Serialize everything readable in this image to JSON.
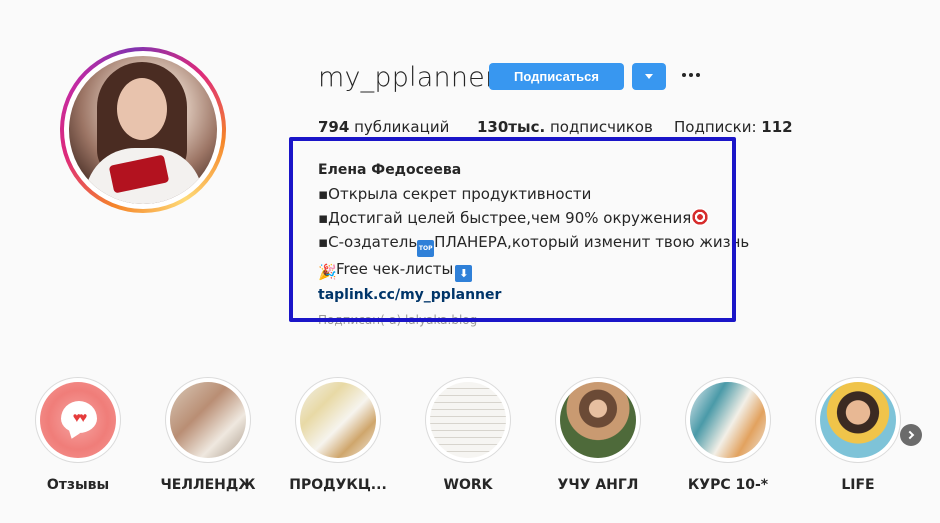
{
  "profile": {
    "username": "my_pplanner",
    "follow_label": "Подписаться",
    "stats": {
      "posts_count": "794",
      "posts_label": "публикаций",
      "followers_count": "130тыс.",
      "followers_label": "подписчиков",
      "following_label": "Подписки:",
      "following_count": "112"
    },
    "bio": {
      "full_name": "Елена Федосеева",
      "line1": "▪Открыла секрет продуктивности",
      "line2": "▪Достигай целей быстрее,чем 90% окружения",
      "line3_a": "▪С-оздатель",
      "line3_b": "ПЛАНЕРА,который изменит твою жизнь",
      "line4": "Free чек-листы",
      "link": "taplink.cc/my_pplanner"
    },
    "followed_by": "Подписан(-а) lalyaka.blog"
  },
  "icons": {
    "top_emoji": "TOP",
    "down_emoji": "⬇",
    "party_emoji": "🎉",
    "hearts": "♥♥"
  },
  "stories": [
    {
      "label": "Отзывы"
    },
    {
      "label": "ЧЕЛЛЕНДЖ"
    },
    {
      "label": "ПРОДУКЦ..."
    },
    {
      "label": "WORK"
    },
    {
      "label": "УЧУ АНГЛ"
    },
    {
      "label": "КУРС 10-*"
    },
    {
      "label": "LIFE"
    }
  ],
  "colors": {
    "accent": "#3897f0",
    "highlight_box": "#1a15c8",
    "link": "#003569"
  }
}
